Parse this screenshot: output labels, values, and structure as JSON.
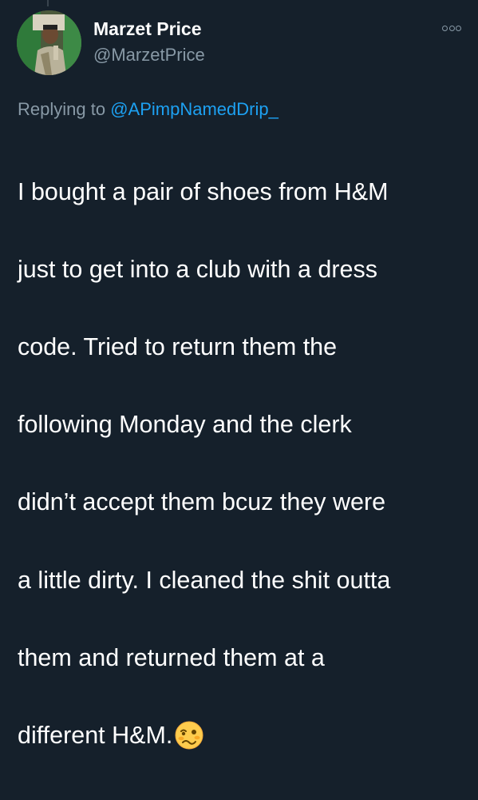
{
  "author": {
    "name": "Marzet Price",
    "handle": "@MarzetPrice"
  },
  "reply": {
    "prefix": "Replying to ",
    "mention": "@APimpNamedDrip_"
  },
  "tweet": {
    "lines": [
      "I bought a pair of shoes from H&M",
      "just to get into a club with a dress",
      "code. Tried to return them the",
      "following Monday and the clerk",
      "didn’t accept them bcuz they were",
      "a little dirty. I cleaned the shit outta",
      "them and returned them at a",
      "different H&M."
    ],
    "emoji": "woozy-face-icon"
  },
  "colors": {
    "background": "#15202b",
    "primary_text": "#ffffff",
    "secondary_text": "#8899a6",
    "link": "#1da1f2"
  },
  "icons": {
    "more": "more-options-icon",
    "avatar": "profile-avatar"
  }
}
